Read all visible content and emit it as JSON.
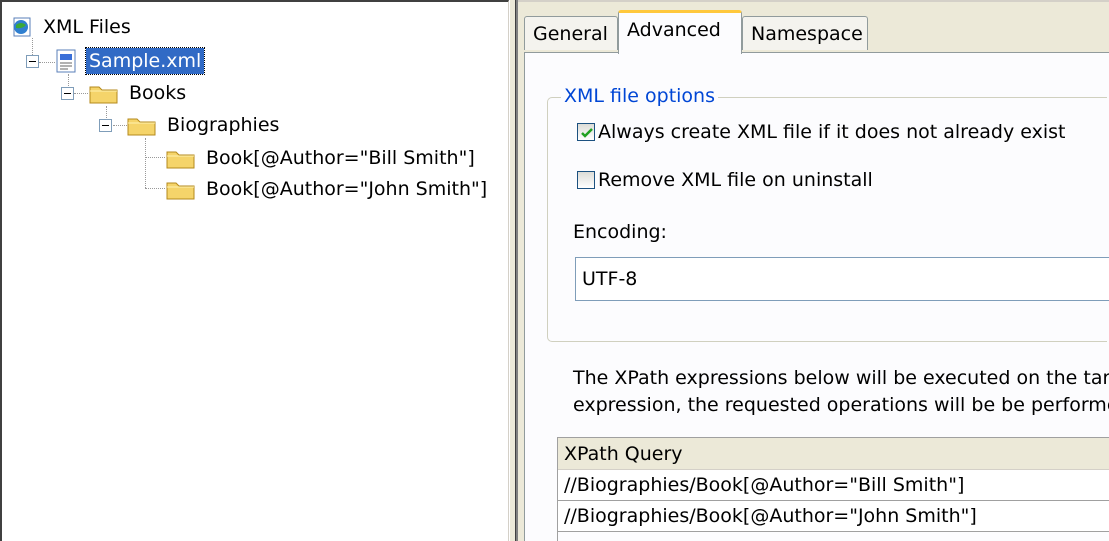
{
  "tree": {
    "root": {
      "label": "XML Files",
      "icon": "xml-files-globe-icon"
    },
    "file": {
      "label": "Sample.xml",
      "icon": "xml-document-icon"
    },
    "books": {
      "label": "Books",
      "icon": "folder-icon"
    },
    "biographies": {
      "label": "Biographies",
      "icon": "folder-icon"
    },
    "items": [
      {
        "label": "Book[@Author=\"Bill Smith\"]",
        "icon": "folder-icon"
      },
      {
        "label": "Book[@Author=\"John Smith\"]",
        "icon": "folder-icon"
      }
    ]
  },
  "tabs": [
    {
      "label": "General"
    },
    {
      "label": "Advanced"
    },
    {
      "label": "Namespace"
    }
  ],
  "active_tab": "Advanced",
  "options": {
    "group_title": "XML file options",
    "always_create": {
      "label": "Always create XML file if it does not already exist",
      "checked": true
    },
    "remove_on_uninstall": {
      "label": "Remove XML file on uninstall",
      "checked": false
    },
    "encoding_label": "Encoding:",
    "encoding_value": "UTF-8"
  },
  "description": {
    "line1": "The XPath expressions below will be executed on the targ",
    "line2": "expression, the requested operations will be be performe"
  },
  "xpath_table": {
    "header": "XPath Query",
    "rows": [
      "//Biographies/Book[@Author=\"Bill Smith\"]",
      "//Biographies/Book[@Author=\"John Smith\"]"
    ]
  },
  "colors": {
    "selection": "#316ac5",
    "group_title": "#0046d5",
    "tab_highlight": "#ffc83c",
    "folder": "#f5d46a"
  }
}
